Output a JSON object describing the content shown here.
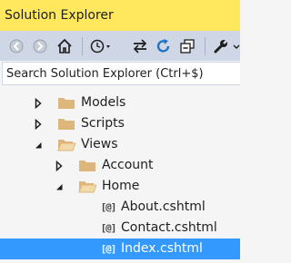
{
  "window": {
    "title": "Solution Explorer"
  },
  "toolbar": {
    "buttons": [
      {
        "name": "back-button",
        "icon": "arrow-left-circle-icon",
        "enabled": false
      },
      {
        "name": "forward-button",
        "icon": "arrow-right-circle-icon",
        "enabled": false
      },
      {
        "name": "home-button",
        "icon": "home-icon",
        "enabled": true
      },
      {
        "name": "pending-changes-filter-button",
        "icon": "clock-icon",
        "enabled": true
      },
      {
        "name": "sync-with-active-document-button",
        "icon": "sync-arrows-icon",
        "enabled": true
      },
      {
        "name": "refresh-button",
        "icon": "refresh-icon",
        "enabled": true
      },
      {
        "name": "collapse-all-button",
        "icon": "collapse-all-icon",
        "enabled": true
      },
      {
        "name": "properties-button",
        "icon": "wrench-icon",
        "enabled": true
      }
    ]
  },
  "search": {
    "placeholder": "Search Solution Explorer (Ctrl+$)"
  },
  "tree": {
    "items": [
      {
        "label": "Models",
        "type": "folder",
        "state": "collapsed",
        "level": 0
      },
      {
        "label": "Scripts",
        "type": "folder",
        "state": "collapsed",
        "level": 0
      },
      {
        "label": "Views",
        "type": "folder-open",
        "state": "expanded",
        "level": 0
      },
      {
        "label": "Account",
        "type": "folder",
        "state": "collapsed",
        "level": 1
      },
      {
        "label": "Home",
        "type": "folder-open",
        "state": "expanded",
        "level": 1
      },
      {
        "label": "About.cshtml",
        "type": "razor-file",
        "level": 2,
        "icon_text": "[@]"
      },
      {
        "label": "Contact.cshtml",
        "type": "razor-file",
        "level": 2,
        "icon_text": "[@]"
      },
      {
        "label": "Index.cshtml",
        "type": "razor-file",
        "level": 2,
        "selected": true,
        "icon_text": "[@]"
      }
    ]
  },
  "colors": {
    "title_bar": "#ffe85d",
    "toolbar": "#cfd6e5",
    "selection": "#3399ff",
    "folder": "#dcb67a"
  }
}
